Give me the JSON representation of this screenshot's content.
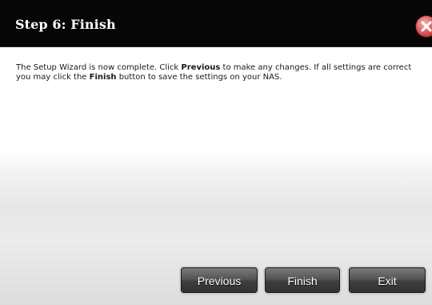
{
  "dialog": {
    "title": "Step 6: Finish",
    "close_icon": "close-x-icon"
  },
  "message": {
    "part1": "The Setup Wizard is now complete. Click ",
    "bold1": "Previous",
    "part2": " to make any changes. If all settings are correct you may click the ",
    "bold2": "Finish",
    "part3": " button to save the settings on your NAS."
  },
  "buttons": {
    "previous": "Previous",
    "finish": "Finish",
    "exit": "Exit"
  },
  "colors": {
    "titlebar": "#060606",
    "close_button": "#c73b3b",
    "button_gradient_top": "#7a7a7a",
    "button_gradient_bottom": "#333333"
  }
}
